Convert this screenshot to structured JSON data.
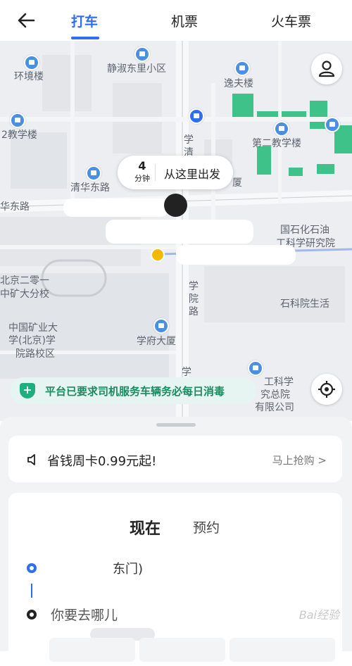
{
  "header": {
    "back_icon": "arrow-left-icon",
    "tabs": [
      {
        "label": "打车",
        "active": true
      },
      {
        "label": "机票",
        "active": false
      },
      {
        "label": "火车票",
        "active": false
      }
    ]
  },
  "map": {
    "pois": {
      "huanjing": "环境楼",
      "jingshu": "静淑东里小区",
      "yifu": "逸夫楼",
      "jiaoxue2a": "2教学楼",
      "jiaoxue2b": "第二教学楼",
      "qinghua": "清华东路",
      "huadong": "华东路",
      "shiyou": "国石化石油",
      "gongke": "工科学研究院",
      "beijing": "北京二零一",
      "zhongkuang": "中矿大分校",
      "zhongguo1": "中国矿业大",
      "zhongguo2": "学(北京)学",
      "zhongguo3": "院路校区",
      "xuefu": "学府大厦",
      "shike": "石科院生活",
      "xueyuan": "学院路",
      "gongkexue": "工科学",
      "jiuzongyuan": "究总院",
      "youxian": "有限公司",
      "xue": "学",
      "qing": "清",
      "sha": "厦",
      "xuemid": "学"
    },
    "bubble": {
      "minutes": "4",
      "unit": "分钟",
      "label": "从这里出发"
    },
    "notice": "平台已要求司机服务车辆务必每日消毒",
    "colors": {
      "map_bg": "#eceef1",
      "green_area": "#3fc28a",
      "accent": "#2f6ef0"
    }
  },
  "promo": {
    "icon": "speaker-icon",
    "text": "省钱周卡0.99元起!",
    "action": "马上抢购",
    "chevron": ">"
  },
  "booking": {
    "modes": [
      {
        "label": "现在",
        "active": true
      },
      {
        "label": "预约",
        "active": false
      }
    ],
    "start_suffix": "东门)",
    "destination_placeholder": "你要去哪儿"
  },
  "watermark": "Bai经验"
}
